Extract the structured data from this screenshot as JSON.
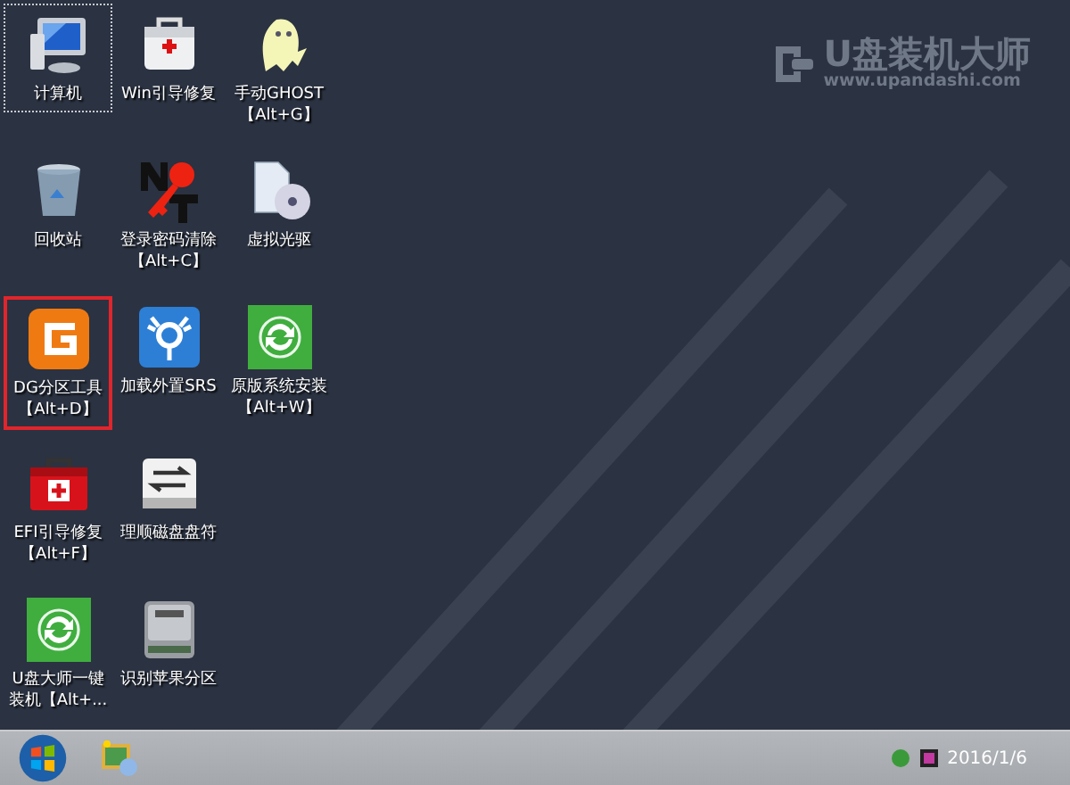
{
  "wallpaper": {
    "logo_title": "U盘装机大师",
    "logo_url": "www.upandashi.com"
  },
  "desktop_rows": [
    {
      "items": [
        {
          "kind": "computer",
          "lines": [
            "计算机"
          ],
          "selected": true,
          "highlighted": false
        },
        {
          "kind": "medkit",
          "lines": [
            "Win引导修复"
          ],
          "selected": false,
          "highlighted": false
        },
        {
          "kind": "ghost",
          "lines": [
            "手动GHOST",
            "【Alt+G】"
          ],
          "selected": false,
          "highlighted": false
        }
      ]
    },
    {
      "items": [
        {
          "kind": "recycle-bin",
          "lines": [
            "回收站"
          ],
          "selected": false,
          "highlighted": false
        },
        {
          "kind": "key",
          "lines": [
            "登录密码清除",
            "【Alt+C】"
          ],
          "selected": false,
          "highlighted": false
        },
        {
          "kind": "disc",
          "lines": [
            "虚拟光驱"
          ],
          "selected": false,
          "highlighted": false
        }
      ]
    },
    {
      "items": [
        {
          "kind": "dg",
          "lines": [
            "DG分区工具",
            "【Alt+D】"
          ],
          "selected": false,
          "highlighted": true
        },
        {
          "kind": "firewire",
          "lines": [
            "加载外置SRS"
          ],
          "selected": false,
          "highlighted": false
        },
        {
          "kind": "refresh",
          "lines": [
            "原版系统安装",
            "【Alt+W】"
          ],
          "selected": false,
          "highlighted": false
        }
      ]
    },
    {
      "items": [
        {
          "kind": "red-toolbox",
          "lines": [
            "EFI引导修复",
            "【Alt+F】"
          ],
          "selected": false,
          "highlighted": false
        },
        {
          "kind": "swap-drive",
          "lines": [
            "理顺磁盘盘符"
          ],
          "selected": false,
          "highlighted": false
        }
      ]
    },
    {
      "items": [
        {
          "kind": "refresh",
          "lines": [
            "U盘大师一键",
            "装机【Alt+..."
          ],
          "selected": false,
          "highlighted": false
        },
        {
          "kind": "hard-drive",
          "lines": [
            "识别苹果分区"
          ],
          "selected": false,
          "highlighted": false
        }
      ]
    }
  ],
  "taskbar": {
    "clock": "2016/1/6"
  }
}
